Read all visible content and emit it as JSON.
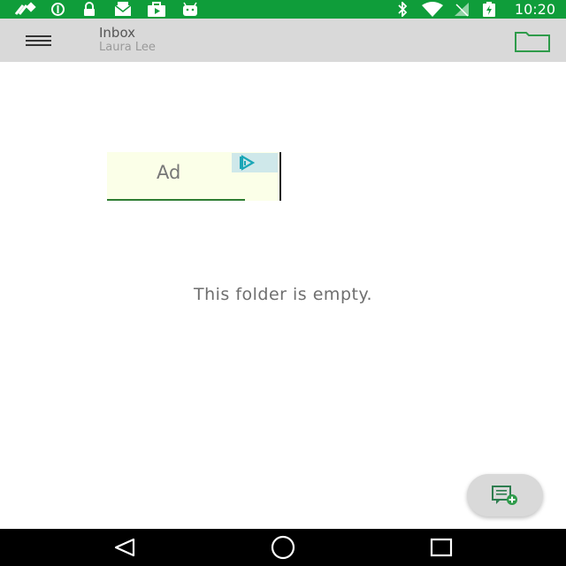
{
  "status_bar": {
    "time": "10:20",
    "icons": [
      "satellite-icon",
      "data-saver-icon",
      "lock-icon",
      "mail-icon",
      "play-store-icon",
      "android-icon",
      "bluetooth-icon",
      "wifi-icon",
      "no-sim-icon",
      "battery-icon"
    ],
    "color": "#0f9d3a"
  },
  "app_bar": {
    "title": "Inbox",
    "subtitle": "Laura Lee",
    "menu_icon": "hamburger-icon",
    "folder_icon": "folder-icon",
    "accent": "#2e9b4a"
  },
  "ad": {
    "label": "Ad",
    "choices_icon": "adchoices-icon"
  },
  "main": {
    "empty_message": "This folder is empty."
  },
  "fab": {
    "icon": "compose-message-icon"
  },
  "nav_bar": {
    "icons": [
      "back-icon",
      "home-icon",
      "recents-icon"
    ]
  }
}
